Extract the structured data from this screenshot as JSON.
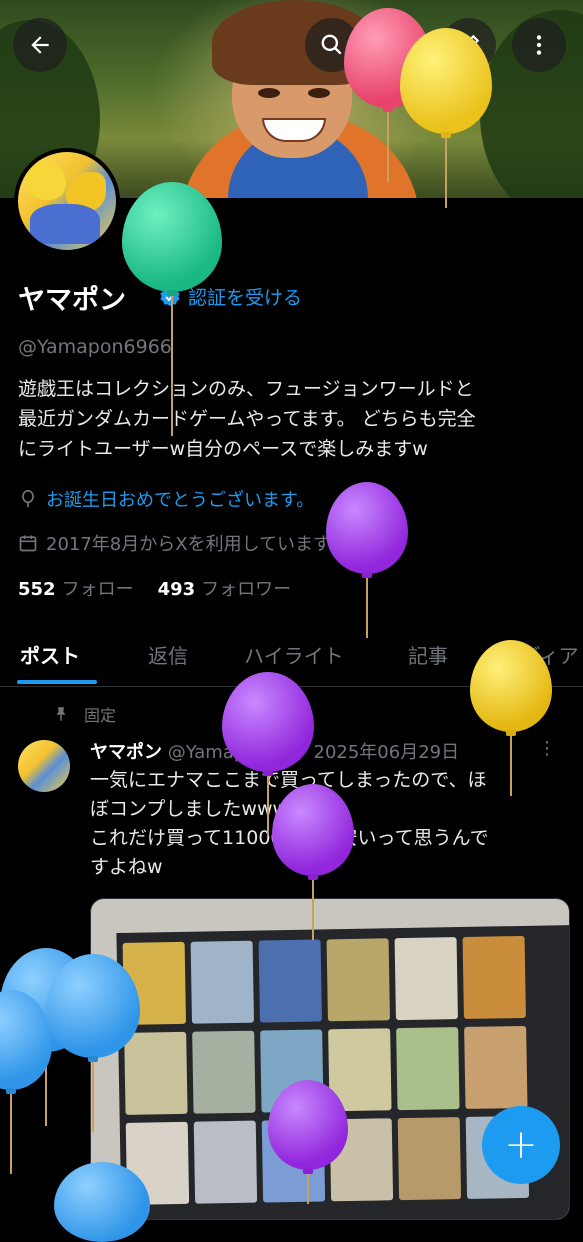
{
  "profile": {
    "name": "ヤマポン",
    "verify_label": "認証を受ける",
    "handle": "@Yamapon6966",
    "bio": "遊戯王はコレクションのみ、フュージョンワールドと\n最近ガンダムカードゲームやってます。 どちらも完全\nにライトユーザーw自分のペースで楽しみますw",
    "birthday": "お誕生日おめでとうございます。",
    "joined": "2017年8月からXを利用しています",
    "following_count": "552",
    "following_label": "フォロー",
    "followers_count": "493",
    "followers_label": "フォロワー"
  },
  "tabs": [
    "ポスト",
    "返信",
    "ハイライト",
    "記事",
    "メディア"
  ],
  "pinned_label": "固定",
  "post": {
    "author": "ヤマポン",
    "handle": "@Yamapon6...",
    "date": "· 2025年06月29日",
    "text": "一気にエナマここまで買ってしまったので、ほ\nぼコンプしましたwww\nこれだけ買って11000円って安いって思うんで\nすよねw"
  },
  "fab_label": "+",
  "colors": {
    "accent": "#1d9bf0",
    "background": "#000000",
    "muted": "#71767b"
  },
  "icons": [
    "back-arrow-icon",
    "search-icon",
    "edit-icon",
    "more-vert-icon",
    "verified-badge-icon",
    "balloon-icon",
    "calendar-icon",
    "pin-icon",
    "chevron-right-icon"
  ]
}
